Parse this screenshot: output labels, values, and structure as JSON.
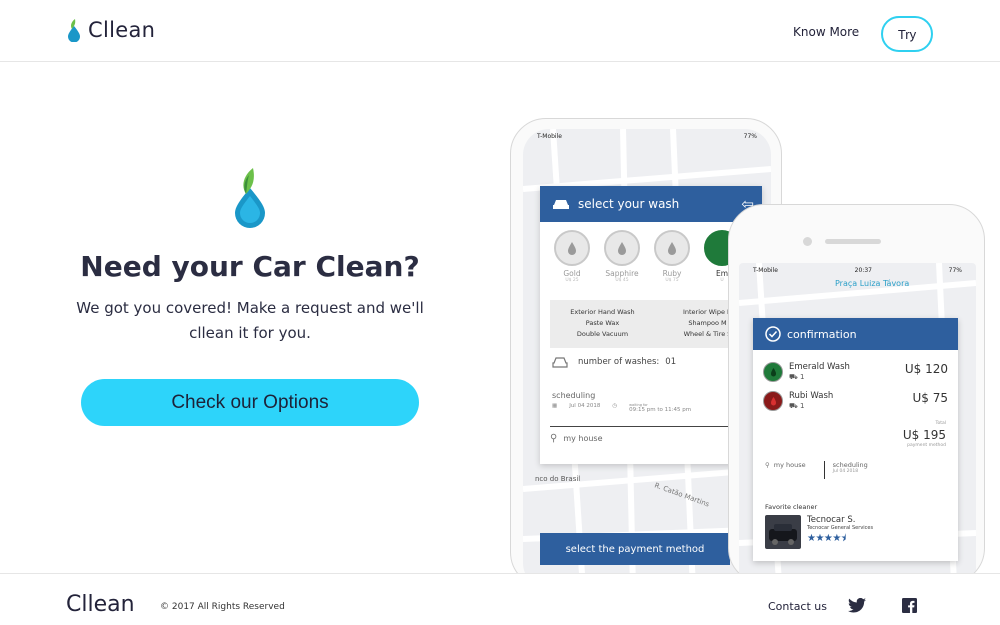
{
  "header": {
    "brand": "Cllean",
    "know_more": "Know More",
    "try": "Try"
  },
  "hero": {
    "title": "Need your Car Clean?",
    "subtitle_line1": "We got you covered! Make a request and we'll",
    "subtitle_line2": "cllean it for you.",
    "cta": "Check our Options"
  },
  "phone_back": {
    "carrier": "T-Mobile",
    "battery": "77%",
    "card_title": "select your wash",
    "washes": [
      {
        "name": "Gold",
        "price": "U$ 25"
      },
      {
        "name": "Sapphire",
        "price": "U$ 45"
      },
      {
        "name": "Ruby",
        "price": "U$ 75"
      },
      {
        "name": "Em",
        "price": "U"
      }
    ],
    "services_col1": [
      "Exterior Hand Wash",
      "Paste Wax",
      "Double Vacuum"
    ],
    "services_col2": [
      "Interior Wipe D",
      "Shampoo M",
      "Wheel & Tire S"
    ],
    "washes_label": "number of washes:",
    "washes_count": "01",
    "scheduling": "scheduling",
    "date": "Jul 04 2018",
    "waiting_for": "waiting for",
    "time": "09:15 pm to 11:45 pm",
    "address": "my house",
    "map_label": "nco do Brasil",
    "map_label2": "R. Catão Martins",
    "payment_button": "select the payment method"
  },
  "phone_front": {
    "carrier": "T-Mobile",
    "time": "20:37",
    "battery": "77%",
    "map_label": "Praça Luiza Távora",
    "card_title": "confirmation",
    "items": [
      {
        "name": "Emerald Wash",
        "qty": "1",
        "price": "U$ 120",
        "color": "#1f7a3a"
      },
      {
        "name": "Rubi Wash",
        "qty": "1",
        "price": "U$ 75",
        "color": "#8a1a1a"
      }
    ],
    "total_label": "Total",
    "total": "U$ 195",
    "payment_label": "payment method",
    "address": "my house",
    "scheduling": "scheduling",
    "date": "Jul 04 2018",
    "favorite_label": "Favorite cleaner",
    "cleaner_name": "Tecnocar S.",
    "cleaner_company": "Tecnocar General Services",
    "rating": 4.5
  },
  "footer": {
    "brand": "Cllean",
    "copyright": "© 2017 All Rights Reserved",
    "contact": "Contact us"
  },
  "colors": {
    "accent": "#2dd4fa",
    "primary_blue": "#2e5f9e",
    "text_dark": "#2b2d42"
  }
}
